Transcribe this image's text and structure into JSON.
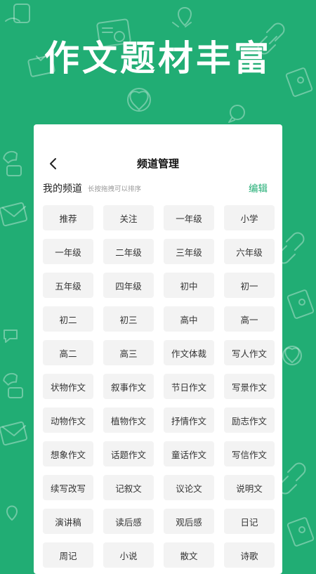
{
  "banner": {
    "headline": "作文题材丰富"
  },
  "colors": {
    "background": "#21ad74",
    "accent": "#21ad74",
    "chip_bg": "#f3f3f3"
  },
  "screen": {
    "back_icon": "chevron-left-icon",
    "title": "频道管理",
    "section_title": "我的频道",
    "section_hint": "长按拖拽可以排序",
    "edit_label": "编辑",
    "channels": [
      "推荐",
      "关注",
      "一年级",
      "小学",
      "一年级",
      "二年级",
      "三年级",
      "六年级",
      "五年级",
      "四年级",
      "初中",
      "初一",
      "初二",
      "初三",
      "高中",
      "高一",
      "高二",
      "高三",
      "作文体裁",
      "写人作文",
      "状物作文",
      "叙事作文",
      "节日作文",
      "写景作文",
      "动物作文",
      "植物作文",
      "抒情作文",
      "励志作文",
      "想象作文",
      "话题作文",
      "童话作文",
      "写信作文",
      "续写改写",
      "记叙文",
      "议论文",
      "说明文",
      "演讲稿",
      "读后感",
      "观后感",
      "日记",
      "周记",
      "小说",
      "散文",
      "诗歌"
    ]
  }
}
